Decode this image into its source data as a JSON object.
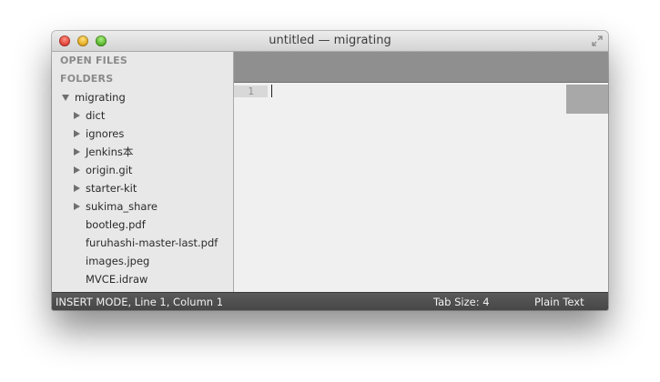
{
  "window": {
    "title": "untitled — migrating"
  },
  "sidebar": {
    "open_files_label": "OPEN FILES",
    "folders_label": "FOLDERS",
    "root_folder": "migrating",
    "folders": [
      "dict",
      "ignores",
      "Jenkins本",
      "origin.git",
      "starter-kit",
      "sukima_share"
    ],
    "files": [
      "bootleg.pdf",
      "furuhashi-master-last.pdf",
      "images.jpeg",
      "MVCE.idraw"
    ]
  },
  "editor": {
    "line_number": "1"
  },
  "statusbar": {
    "position": "INSERT MODE, Line 1, Column 1",
    "tab_size": "Tab Size: 4",
    "syntax": "Plain Text"
  }
}
